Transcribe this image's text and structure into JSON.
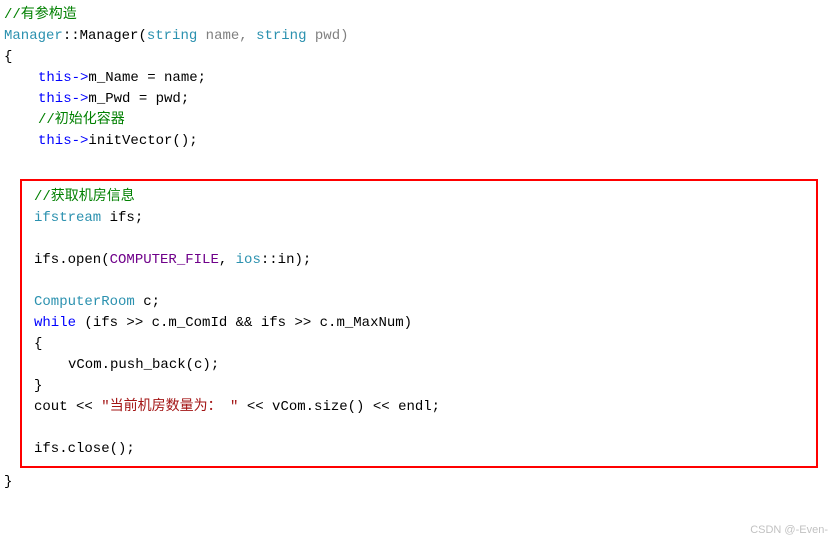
{
  "code": {
    "l1_comment": "//有参构造",
    "l2_cls": "Manager",
    "l2_sep": "::",
    "l2_ctor": "Manager",
    "l2_open": "(",
    "l2_t1": "string",
    "l2_p1": " name, ",
    "l2_t2": "string",
    "l2_p2": " pwd)",
    "l3": "{",
    "l4_pre": "this",
    "l4_arrow": "->",
    "l4_rest": "m_Name = name;",
    "l5_pre": "this",
    "l5_arrow": "->",
    "l5_rest": "m_Pwd = pwd;",
    "l6_comment": "//初始化容器",
    "l7_pre": "this",
    "l7_arrow": "->",
    "l7_rest": "initVector();",
    "block": {
      "b1_comment": "//获取机房信息",
      "b2_type": "ifstream",
      "b2_rest": " ifs;",
      "b3_pre": "ifs.open(",
      "b3_macro": "COMPUTER_FILE",
      "b3_mid": ", ",
      "b3_cls": "ios",
      "b3_rest": "::in);",
      "b4_type": "ComputerRoom",
      "b4_rest": " c;",
      "b5_kw": "while",
      "b5_rest": " (ifs >> c.m_ComId && ifs >> c.m_MaxNum)",
      "b6": "{",
      "b7": "vCom.push_back(c);",
      "b8": "}",
      "b9_pre": "cout << ",
      "b9_str": "\"当前机房数量为： \"",
      "b9_rest": " << vCom.size() << endl;",
      "b10": "ifs.close();"
    },
    "l_end": "}"
  },
  "watermark": "CSDN @-Even-"
}
